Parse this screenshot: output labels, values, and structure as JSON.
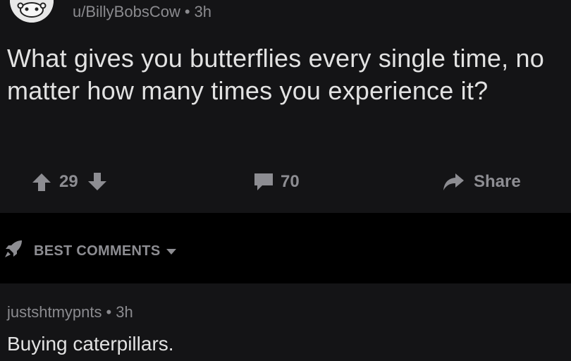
{
  "post": {
    "author": "u/BillyBobsCow",
    "age": "3h",
    "meta_separator": "•",
    "title": "What gives you butterflies every single time, no matter how many times you experience it?",
    "score": "29",
    "comment_count": "70",
    "share_label": "Share"
  },
  "sort": {
    "label": "BEST COMMENTS"
  },
  "comment": {
    "author": "justshtmypnts",
    "age": "3h",
    "meta_separator": "•",
    "body": "Buying caterpillars."
  },
  "icons": {
    "avatar": "reddit-snoo-avatar",
    "upvote": "arrow-up-icon",
    "downvote": "arrow-down-icon",
    "comments": "comment-bubble-icon",
    "share": "share-arrow-icon",
    "sort": "rocket-icon",
    "caret": "caret-down-icon"
  },
  "colors": {
    "post_bg": "#141416",
    "page_bg": "#000000",
    "text_primary": "#e2e2e2",
    "text_muted": "#8b8b8f"
  }
}
